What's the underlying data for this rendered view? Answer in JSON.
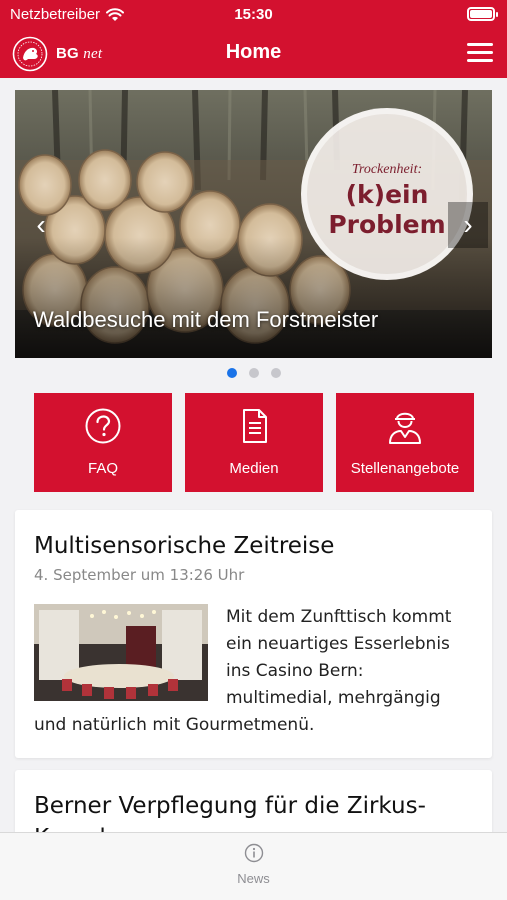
{
  "status_bar": {
    "carrier": "Netzbetreiber",
    "time": "15:30"
  },
  "nav": {
    "brand_bold": "BG",
    "brand_italic": "net",
    "title": "Home"
  },
  "carousel": {
    "badge_sub": "Trockenheit:",
    "badge_main": "(k)ein Problem",
    "caption": "Waldbesuche mit dem Forstmeister",
    "current_slide": 1,
    "slide_count": 3
  },
  "tiles": [
    {
      "label": "FAQ",
      "icon": "question-circle-icon"
    },
    {
      "label": "Medien",
      "icon": "document-icon"
    },
    {
      "label": "Stellenangebote",
      "icon": "worker-icon"
    }
  ],
  "articles": [
    {
      "title": "Multisensorische Zeitreise",
      "date": "4. September um 13:26 Uhr",
      "excerpt": "Mit dem Zunfttisch kommt ein neuartiges Esserlebnis ins Casino Bern: multimedial, mehrgängig und natürlich mit Gourmetmenü."
    },
    {
      "title": "Berner Verpflegung für die Zirkus-Kamele"
    }
  ],
  "tab_bar": {
    "tab_label": "News",
    "tab_icon": "info-circle-icon"
  },
  "colors": {
    "brand_red": "#d3112f",
    "badge_text": "#7c1e2e",
    "active_dot": "#1a73e8"
  }
}
